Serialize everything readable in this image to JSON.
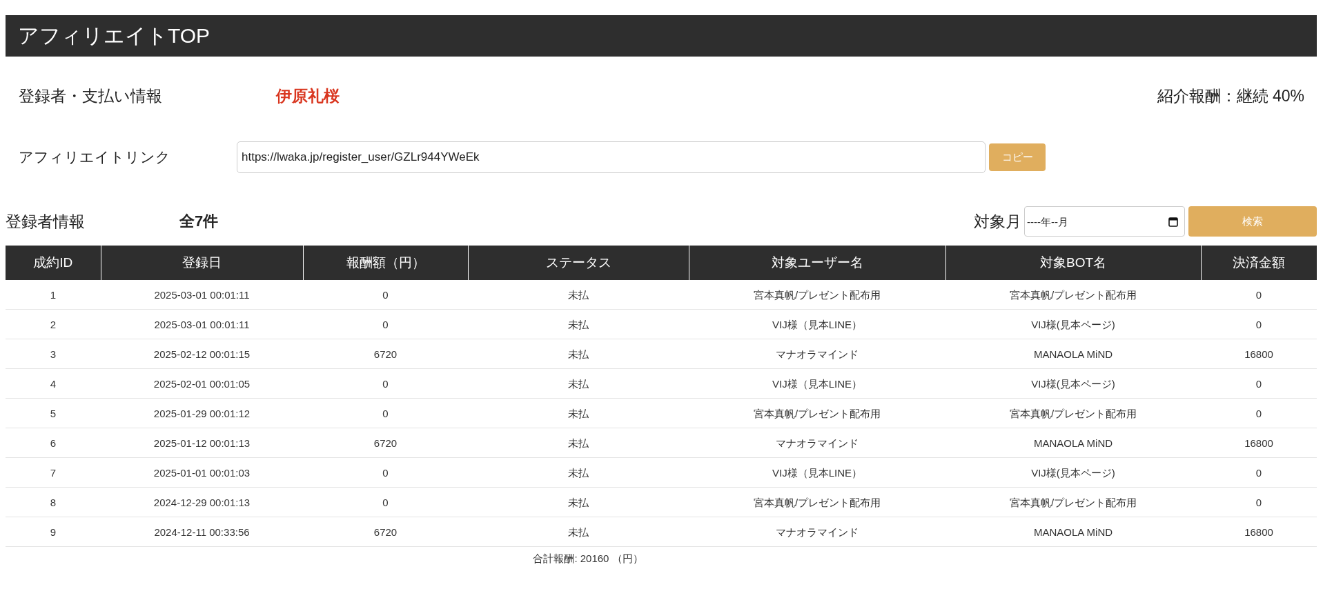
{
  "header": {
    "title": "アフィリエイトTOP"
  },
  "registrant": {
    "label": "登録者・支払い情報",
    "name": "伊原礼桜",
    "commission": "紹介報酬：継続 40%"
  },
  "affiliate_link": {
    "label": "アフィリエイトリンク",
    "value": "https://lwaka.jp/register_user/GZLr944YWeEk",
    "button": "コピー"
  },
  "registrants": {
    "label": "登録者情報",
    "count": "全7件",
    "month_label": "対象月",
    "month_placeholder": "----年--月",
    "search_button": "検索"
  },
  "table": {
    "columns": [
      "成約ID",
      "登録日",
      "報酬額（円）",
      "ステータス",
      "対象ユーザー名",
      "対象BOT名",
      "決済金額"
    ],
    "rows": [
      [
        "1",
        "2025-03-01 00:01:11",
        "0",
        "未払",
        "宮本真帆/プレゼント配布用",
        "宮本真帆/プレゼント配布用",
        "0"
      ],
      [
        "2",
        "2025-03-01 00:01:11",
        "0",
        "未払",
        "VIJ様（見本LINE）",
        "VIJ様(見本ページ)",
        "0"
      ],
      [
        "3",
        "2025-02-12 00:01:15",
        "6720",
        "未払",
        "マナオラマインド",
        "MANAOLA MiND",
        "16800"
      ],
      [
        "4",
        "2025-02-01 00:01:05",
        "0",
        "未払",
        "VIJ様（見本LINE）",
        "VIJ様(見本ページ)",
        "0"
      ],
      [
        "5",
        "2025-01-29 00:01:12",
        "0",
        "未払",
        "宮本真帆/プレゼント配布用",
        "宮本真帆/プレゼント配布用",
        "0"
      ],
      [
        "6",
        "2025-01-12 00:01:13",
        "6720",
        "未払",
        "マナオラマインド",
        "MANAOLA MiND",
        "16800"
      ],
      [
        "7",
        "2025-01-01 00:01:03",
        "0",
        "未払",
        "VIJ様（見本LINE）",
        "VIJ様(見本ページ)",
        "0"
      ],
      [
        "8",
        "2024-12-29 00:01:13",
        "0",
        "未払",
        "宮本真帆/プレゼント配布用",
        "宮本真帆/プレゼント配布用",
        "0"
      ],
      [
        "9",
        "2024-12-11 00:33:56",
        "6720",
        "未払",
        "マナオラマインド",
        "MANAOLA MiND",
        "16800"
      ]
    ],
    "total": "合計報酬: 20160 （円）"
  }
}
